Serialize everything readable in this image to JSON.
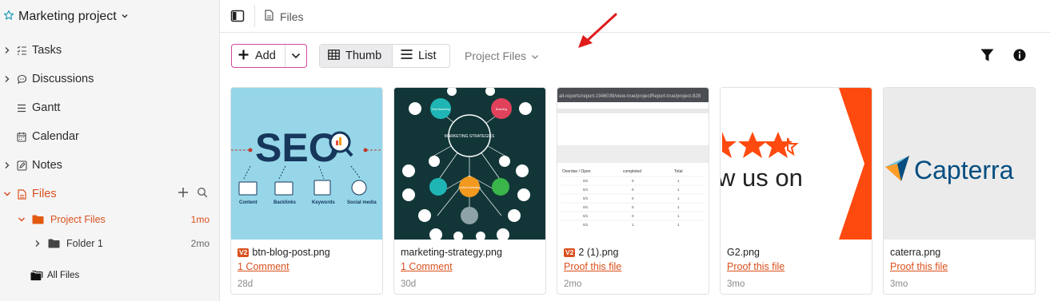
{
  "project": {
    "title": "Marketing project",
    "star_icon": "star-outline-icon",
    "dropdown_icon": "chevron-down-icon"
  },
  "nav": {
    "tasks": "Tasks",
    "discussions": "Discussions",
    "gantt": "Gantt",
    "calendar": "Calendar",
    "notes": "Notes",
    "files": "Files"
  },
  "tree": {
    "project_files": {
      "label": "Project Files",
      "age": "1mo"
    },
    "folder1": {
      "label": "Folder 1",
      "age": "2mo"
    },
    "all_files": {
      "label": "All Files"
    }
  },
  "breadcrumb": {
    "label": "Files"
  },
  "toolbar": {
    "add_label": "Add",
    "thumb_label": "Thumb",
    "list_label": "List",
    "scope_label": "Project Files"
  },
  "colors": {
    "accent": "#d9501c",
    "add_border": "#d24a9c",
    "active_view_bg": "#ebebed",
    "arrow": "#e01b1b"
  },
  "cards": [
    {
      "name": "btn-blog-post.png",
      "version": "V2",
      "link": "1 Comment",
      "age": "28d"
    },
    {
      "name": "marketing-strategy.png",
      "version": "",
      "link": "1 Comment",
      "age": "30d"
    },
    {
      "name": "2 (1).png",
      "version": "V2",
      "link": "Proof this file",
      "age": "2mo"
    },
    {
      "name": "G2.png",
      "version": "",
      "link": "Proof this file",
      "age": "3mo"
    },
    {
      "name": "caterra.png",
      "version": "",
      "link": "Proof this file",
      "age": "3mo"
    }
  ],
  "thumbs": {
    "seo": {
      "title": "SEO",
      "labels": [
        "Content",
        "Backlinks",
        "Keywords",
        "Social media"
      ]
    },
    "strategy": {
      "center": "MARKETING STRATEGIES",
      "nodes": [
        "Viral Marketing",
        "Branding",
        "Content Marketing"
      ]
    },
    "report": {
      "url": "all-reports/report-1946039/view-true/projectReport-true/project-828",
      "headers": [
        "Overdue / Open",
        "completed",
        "Total"
      ],
      "rows": [
        [
          "0/1",
          "0",
          "1"
        ],
        [
          "0/1",
          "0",
          "1"
        ],
        [
          "0/1",
          "0",
          "1"
        ],
        [
          "0/1",
          "0",
          "1"
        ],
        [
          "0/1",
          "0",
          "1"
        ],
        [
          "0/1",
          "1",
          "1"
        ]
      ]
    },
    "g2": {
      "text": "w us on"
    },
    "capterra": {
      "text": "Capterra"
    }
  }
}
